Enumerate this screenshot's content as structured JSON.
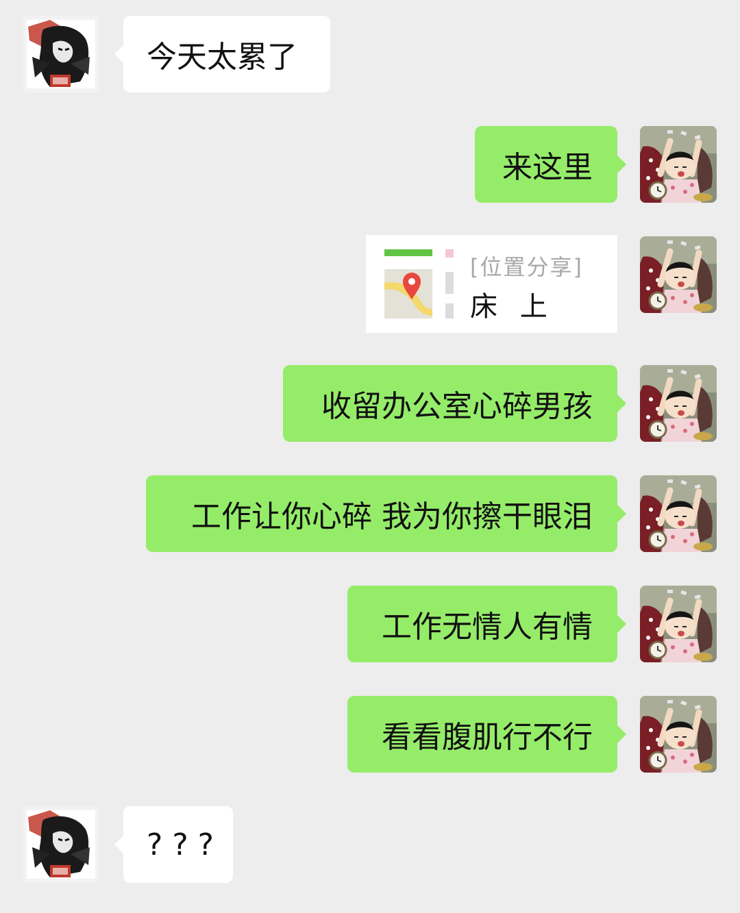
{
  "chat": {
    "messages": [
      {
        "sender": "contact",
        "text": "今天太累了"
      },
      {
        "sender": "me",
        "text": "来这里"
      },
      {
        "sender": "me",
        "type": "location",
        "tag": "[位置分享]",
        "place": "床 上"
      },
      {
        "sender": "me",
        "text": "收留办公室心碎男孩"
      },
      {
        "sender": "me",
        "text": "工作让你心碎 我为你擦干眼泪"
      },
      {
        "sender": "me",
        "text": "工作无情人有情"
      },
      {
        "sender": "me",
        "text": "看看腹肌行不行"
      },
      {
        "sender": "contact",
        "text": "? ? ?"
      }
    ]
  },
  "avatars": {
    "contact": "dark-manga-avatar-icon",
    "me": "cartoon-girl-waking-avatar-icon"
  },
  "colors": {
    "background": "#ededed",
    "outgoing_bubble": "#95ec69",
    "incoming_bubble": "#ffffff",
    "location_tag": "#a8a8a8",
    "map_pin": "#e8473f"
  }
}
